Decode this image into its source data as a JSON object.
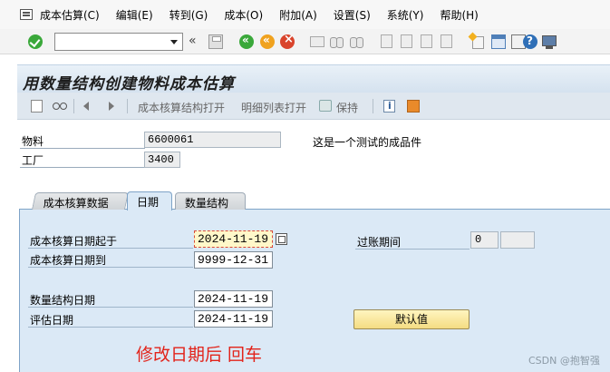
{
  "menu": [
    "成本估算(C)",
    "编辑(E)",
    "转到(G)",
    "成本(O)",
    "附加(A)",
    "设置(S)",
    "系统(Y)",
    "帮助(H)"
  ],
  "toolbar": {
    "command_value": "",
    "collapse_glyph": "«"
  },
  "page_title": "用数量结构创建物料成本估算",
  "app_toolbar": {
    "costing_structure_open": "成本核算结构打开",
    "detail_list_open": "明细列表打开",
    "keep": "保持"
  },
  "header": {
    "material_label": "物料",
    "material_value": "6600061",
    "material_desc": "这是一个测试的成品件",
    "plant_label": "工厂",
    "plant_value": "3400"
  },
  "tabs": [
    "成本核算数据",
    "日期",
    "数量结构"
  ],
  "dates": {
    "costing_from_label": "成本核算日期起于",
    "costing_from_value": "2024-11-19",
    "costing_to_label": "成本核算日期到",
    "costing_to_value": "9999-12-31",
    "qty_struct_label": "数量结构日期",
    "qty_struct_value": "2024-11-19",
    "valuation_label": "评估日期",
    "valuation_value": "2024-11-19",
    "posting_period_label": "过账期间",
    "posting_period_value": "0",
    "posting_year_value": "",
    "default_button": "默认值"
  },
  "annotation": "修改日期后 回车",
  "watermark": "CSDN @抱智强",
  "colors": {
    "annotation": "#e2231a",
    "panel": "#dbe9f6",
    "highlight": "#fff8c9"
  }
}
